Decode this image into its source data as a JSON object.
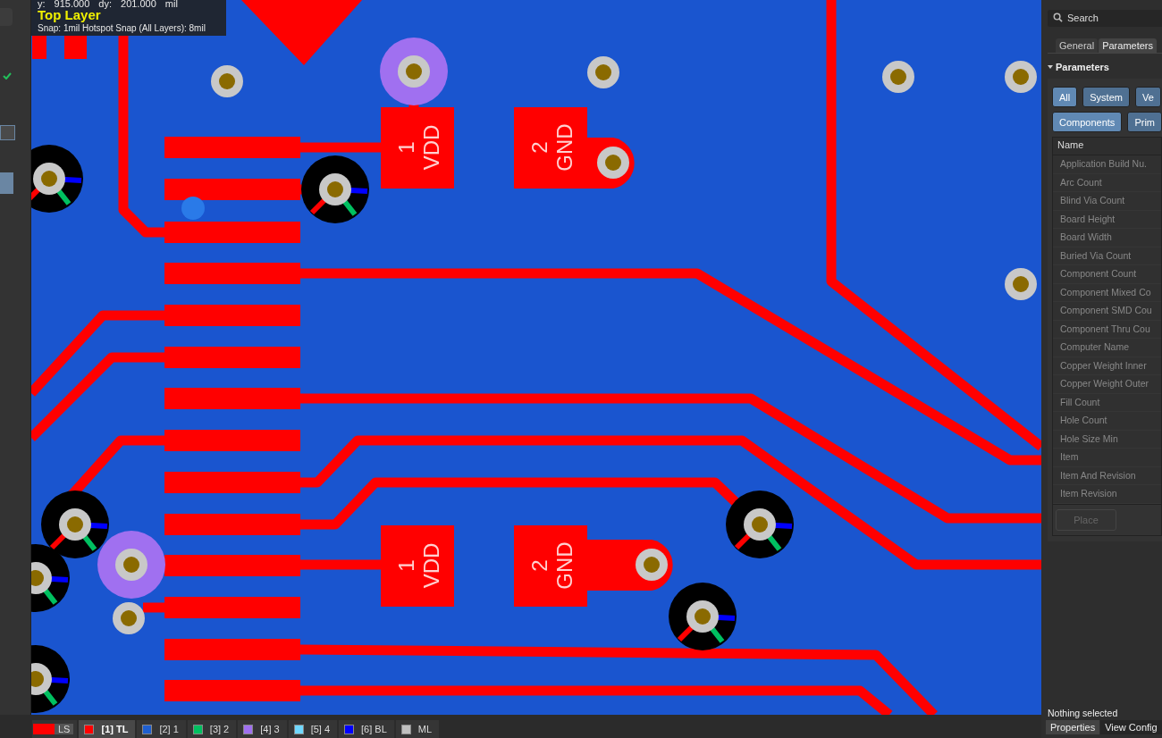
{
  "coordinates": {
    "y_label": "y:",
    "y_value": "915.000",
    "dy_label": "dy:",
    "dy_value": "201.000",
    "unit": "mil"
  },
  "active_layer": "Top Layer",
  "snap": "Snap: 1mil Hotspot Snap (All Layers): 8mil",
  "pcb": {
    "pad_labels": [
      {
        "number": "1",
        "net": "VDD"
      },
      {
        "number": "2",
        "net": "GND"
      },
      {
        "number": "1",
        "net": "VDD"
      },
      {
        "number": "2",
        "net": "GND"
      }
    ]
  },
  "panel": {
    "search_placeholder": "Search",
    "tabs": [
      {
        "label": "General",
        "selected": false
      },
      {
        "label": "Parameters",
        "selected": true
      }
    ],
    "section": {
      "title": "Parameters",
      "expanded": true
    },
    "filter_rows": [
      [
        {
          "label": "All",
          "selected": true
        },
        {
          "label": "System",
          "selected": false
        },
        {
          "label": "Ve",
          "selected": false
        }
      ],
      [
        {
          "label": "Components",
          "selected": true
        },
        {
          "label": "Prim",
          "selected": false
        }
      ]
    ],
    "table": {
      "column": "Name",
      "rows": [
        "Application Build Nu.",
        "Arc Count",
        "Blind Via Count",
        "Board Height",
        "Board Width",
        "Buried Via Count",
        "Component Count",
        "Component Mixed Co",
        "Component SMD Cou",
        "Component Thru Cou",
        "Computer Name",
        "Copper Weight Inner",
        "Copper Weight Outer",
        "Fill Count",
        "Hole Count",
        "Hole Size Min",
        "Item",
        "Item And Revision",
        "Item Revision"
      ]
    },
    "place_button": {
      "label": "Place",
      "disabled": true
    },
    "status": "Nothing selected",
    "bottom_tabs": [
      {
        "label": "Properties",
        "selected": true
      },
      {
        "label": "View Config",
        "selected": false
      }
    ]
  },
  "layer_tabs": [
    {
      "kind": "swatch",
      "label": "LS",
      "color": "#ff0000",
      "selected": false
    },
    {
      "kind": "layer",
      "label": "[1] TL",
      "color": "#ff0000",
      "selected": true
    },
    {
      "kind": "layer",
      "label": "[2] 1",
      "color": "#1f5fd0",
      "selected": false
    },
    {
      "kind": "layer",
      "label": "[3] 2",
      "color": "#00c060",
      "selected": false
    },
    {
      "kind": "layer",
      "label": "[4] 3",
      "color": "#a070f0",
      "selected": false
    },
    {
      "kind": "layer",
      "label": "[5] 4",
      "color": "#70d8ff",
      "selected": false
    },
    {
      "kind": "layer",
      "label": "[6] BL",
      "color": "#0000ff",
      "selected": false
    },
    {
      "kind": "layer",
      "label": "ML",
      "color": "#c0c0c0",
      "selected": false
    }
  ]
}
